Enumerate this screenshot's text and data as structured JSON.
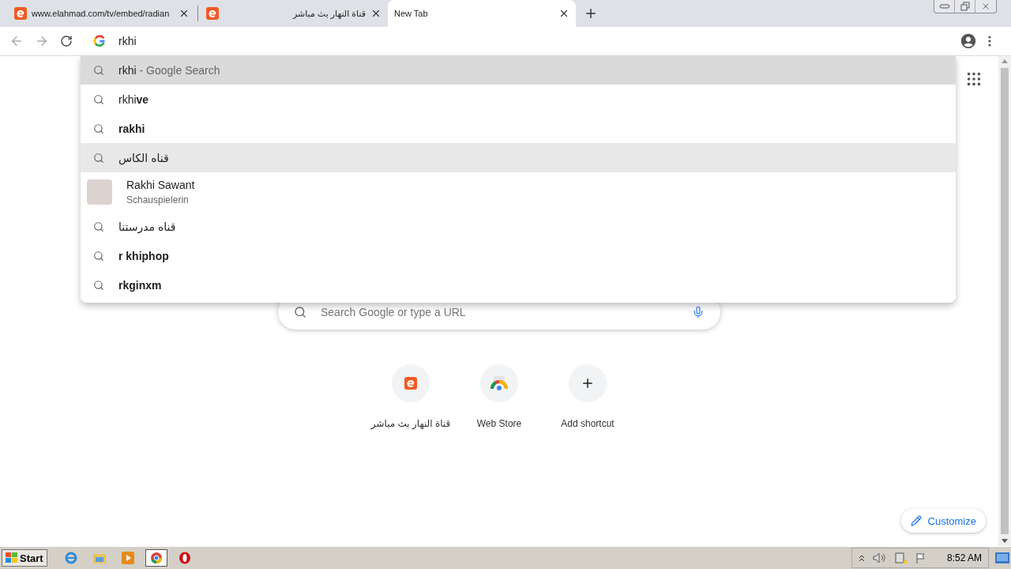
{
  "tabs": [
    {
      "title": "www.elahmad.com/tv/embed/radian",
      "selected": false,
      "favicon": true
    },
    {
      "title": "قناة النهار بث مباشر",
      "selected": false,
      "favicon": true
    },
    {
      "title": "New Tab",
      "selected": true,
      "favicon": false
    }
  ],
  "omnibox": {
    "value": "rkhi"
  },
  "suggestions": [
    {
      "kind": "search",
      "text": "rkhi",
      "description": "- Google Search",
      "selected": true,
      "hovered": false
    },
    {
      "kind": "search",
      "text": "rkhi**ve**",
      "selected": false,
      "hovered": false
    },
    {
      "kind": "search",
      "text": "**rakhi**",
      "selected": false,
      "hovered": false
    },
    {
      "kind": "search",
      "text": "قناه الكاس",
      "selected": false,
      "hovered": true
    },
    {
      "kind": "entity",
      "text": "Rakhi Sawant",
      "description": "Schauspielerin",
      "selected": false,
      "hovered": false
    },
    {
      "kind": "search",
      "text": "قناه مدرستنا",
      "selected": false,
      "hovered": false
    },
    {
      "kind": "search",
      "text": "**r khiphop**",
      "selected": false,
      "hovered": false
    },
    {
      "kind": "search",
      "text": "**rkginxm**",
      "selected": false,
      "hovered": false
    }
  ],
  "search_box": {
    "placeholder": "Search Google or type a URL"
  },
  "shortcuts": [
    {
      "kind": "site",
      "label": "قناة النهار بث مباشر"
    },
    {
      "kind": "webstore",
      "label": "Web Store"
    },
    {
      "kind": "add",
      "label": "Add shortcut"
    }
  ],
  "customize_button": {
    "label": "Customize"
  },
  "taskbar": {
    "start": "Start",
    "clock": "8:52 AM"
  }
}
